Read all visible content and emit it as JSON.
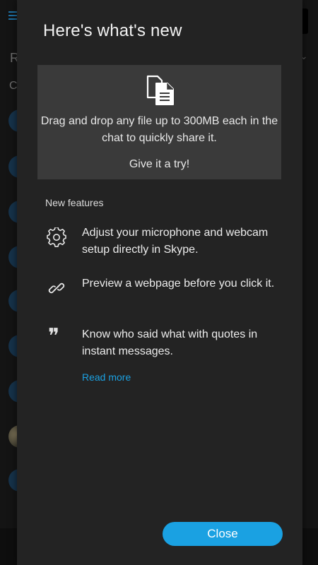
{
  "dialog": {
    "title": "Here's what's new"
  },
  "hero": {
    "icon": "file-share-icon",
    "description": "Drag and drop any file up to 300MB each in the chat to quickly share it.",
    "cta": "Give it a try!"
  },
  "features": {
    "heading": "New features",
    "items": [
      {
        "icon": "gear-icon",
        "text": "Adjust your microphone and webcam setup directly in Skype."
      },
      {
        "icon": "link-icon",
        "text": "Preview a webpage before you click it."
      },
      {
        "icon": "quote-icon",
        "text": "Know who said what with quotes in instant messages."
      }
    ],
    "read_more": "Read more"
  },
  "actions": {
    "close_label": "Close"
  },
  "background": {
    "letter_r": "R",
    "letter_c": "C"
  },
  "colors": {
    "accent": "#1aa1e2",
    "dialog_bg": "#232323",
    "card_bg": "#3a3a3a"
  }
}
